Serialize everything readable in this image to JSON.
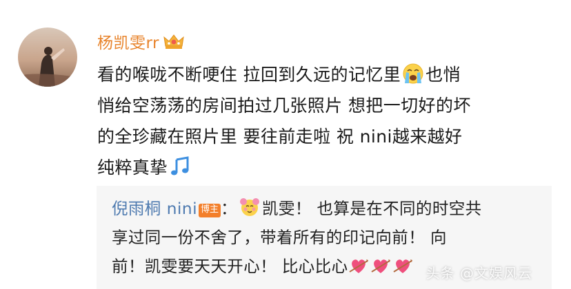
{
  "post": {
    "username": "杨凯雯rr",
    "line1": "看的喉咙不断哽住 拉回到久远的记忆里",
    "line1_tail": "也悄",
    "line2": "悄给空荡荡的房间拍过几张照片 想把一切好的坏",
    "line3": "的全珍藏在照片里 要往前走啦 祝 nini越来越好",
    "line4": "纯粹真挚"
  },
  "reply": {
    "name": "倪雨桐 nini",
    "badge": "博主",
    "colon": "：",
    "line1": "凯雯！ 也算是在不同的时空共",
    "line2": "享过同一份不舍了，带着所有的印记向前！ 向",
    "line3": "前！凯雯要天天开心！ 比心比心"
  },
  "watermark": "头条 @文娱风云",
  "colors": {
    "username": "#e8842c",
    "reply_name": "#4f7bb0",
    "badge_bg": "#f37f2a",
    "reply_bg": "#f6f6f6"
  },
  "icons": [
    "avatar-photo",
    "crown-icon",
    "crying-face-icon",
    "music-notes-icon",
    "flower-face-icon",
    "heart-arrow-icon"
  ]
}
